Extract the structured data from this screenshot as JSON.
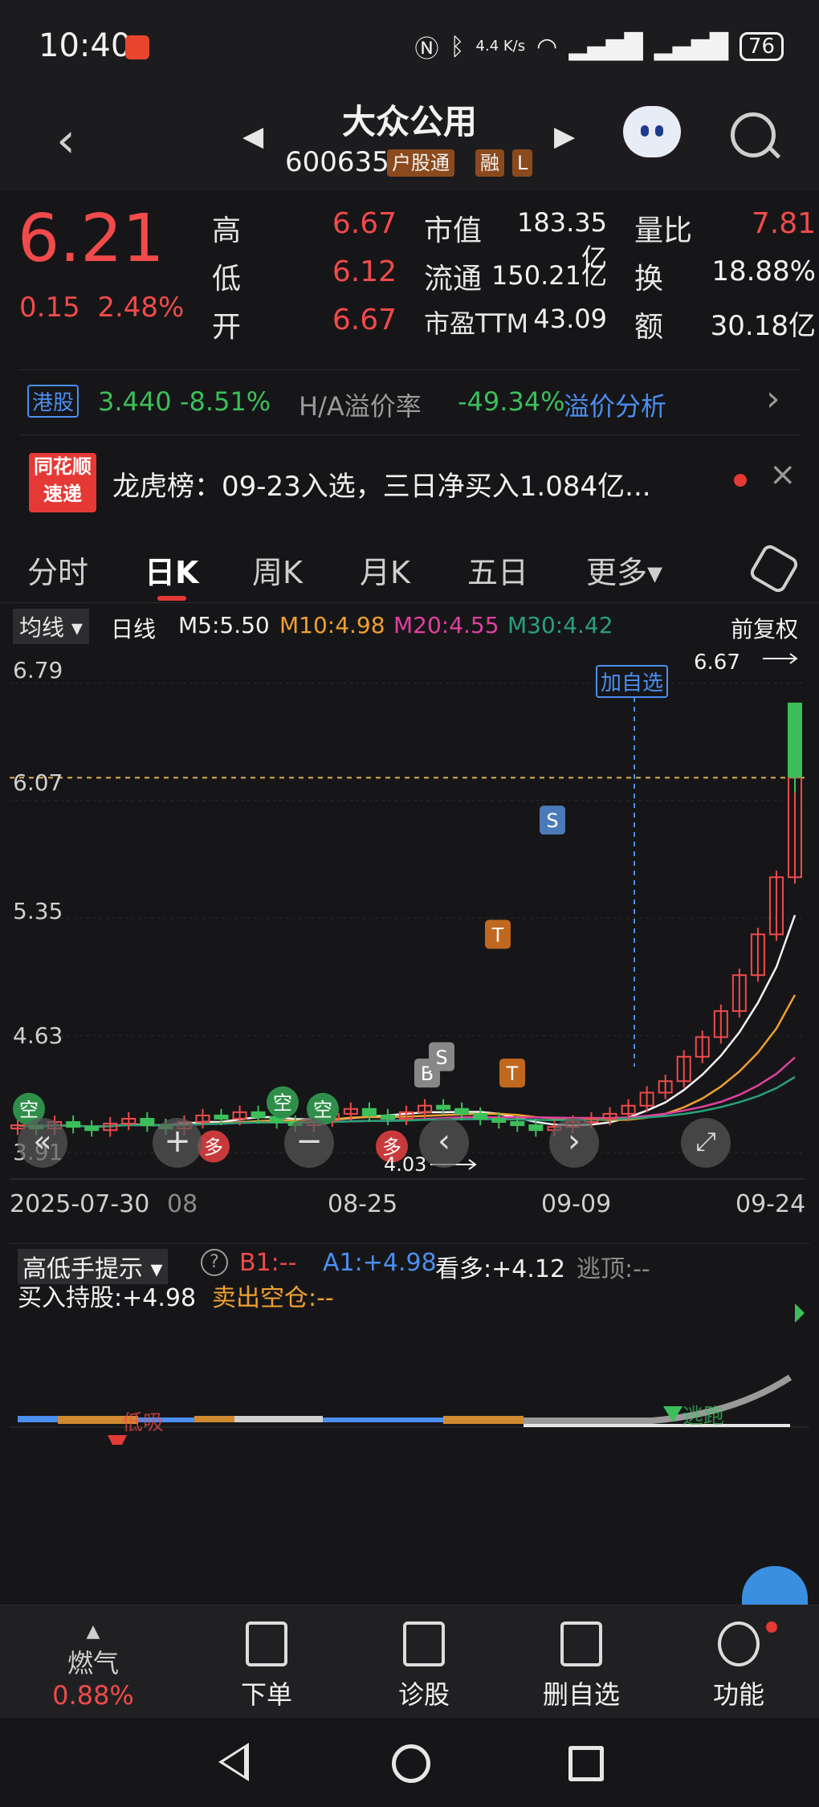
{
  "status_bar": {
    "time": "10:40",
    "net_speed": "4.4 K/s",
    "battery": "76"
  },
  "header": {
    "title": "大众公用",
    "code": "600635",
    "tags": [
      "户股通",
      "融",
      "L"
    ]
  },
  "quote": {
    "price": "6.21",
    "change": "0.15",
    "change_pct": "2.48%",
    "high_label": "高",
    "high": "6.67",
    "low_label": "低",
    "low": "6.12",
    "open_label": "开",
    "open": "6.67",
    "mktcap_label": "市值",
    "mktcap": "183.35亿",
    "float_label": "流通",
    "float": "150.21亿",
    "pe_label": "市盈TTM",
    "pe": "43.09",
    "volratio_label": "量比",
    "volratio": "7.81",
    "turnover_label": "换",
    "turnover": "18.88%",
    "amount_label": "额",
    "amount": "30.18亿"
  },
  "hk": {
    "badge": "港股",
    "price": "3.440",
    "change_pct": "-8.51%",
    "premium_label": "H/A溢价率",
    "premium": "-49.34%",
    "analysis_link": "溢价分析"
  },
  "news": {
    "logo_line1": "同花顺",
    "logo_line2": "速递",
    "text": "龙虎榜：09-23入选，三日净买入1.084亿..."
  },
  "tabs": [
    "分时",
    "日K",
    "周K",
    "月K",
    "五日",
    "更多▾"
  ],
  "ma": {
    "selector": "均线 ▾",
    "period": "日线",
    "m5": "M5:5.50",
    "m10": "M10:4.98",
    "m20": "M20:4.55",
    "m30": "M30:4.42",
    "adjust": "前复权"
  },
  "chart_labels": {
    "y_ticks": [
      "6.79",
      "6.07",
      "5.35",
      "4.63",
      "3.91"
    ],
    "x_ticks": [
      "2025-07-30",
      "08",
      "08-25",
      "09-09",
      "09-24"
    ],
    "add_watch": "加自选",
    "high_marker": "6.67",
    "low_marker": "4.03",
    "signals": [
      "空",
      "空",
      "空",
      "多",
      "多",
      "B",
      "S",
      "T",
      "T",
      "S"
    ]
  },
  "chart_data": {
    "type": "candlestick",
    "y_axis": {
      "ticks": [
        6.79,
        6.07,
        5.35,
        4.63,
        3.91
      ]
    },
    "x_ticks": [
      "2025-07-30",
      "08-25",
      "09-09",
      "09-24"
    ],
    "current_price": 6.21,
    "high": 6.67,
    "low": 4.03,
    "moving_averages": {
      "M5": 5.5,
      "M10": 4.98,
      "M20": 4.55,
      "M30": 4.42
    },
    "candles_close": [
      4.08,
      4.06,
      4.1,
      4.07,
      4.05,
      4.09,
      4.12,
      4.08,
      4.06,
      4.1,
      4.14,
      4.12,
      4.16,
      4.13,
      4.1,
      4.08,
      4.11,
      4.15,
      4.18,
      4.14,
      4.12,
      4.16,
      4.2,
      4.18,
      4.15,
      4.12,
      4.1,
      4.08,
      4.05,
      4.07,
      4.1,
      4.12,
      4.15,
      4.2,
      4.28,
      4.35,
      4.5,
      4.62,
      4.78,
      5.0,
      5.25,
      5.6,
      6.21
    ]
  },
  "indicator": {
    "name": "高低手提示 ▾",
    "help": "?",
    "b1": "B1:--",
    "a1": "A1:+4.98",
    "bull": "看多:+4.12",
    "top": "逃顶:--",
    "hold": "买入持股:+4.98",
    "sell": "卖出空仓:--",
    "low_suck": "低吸",
    "escape": "逃跑"
  },
  "bottom_bar": [
    {
      "label": "燃气",
      "sub": "0.88%"
    },
    {
      "label": "下单"
    },
    {
      "label": "诊股"
    },
    {
      "label": "删自选"
    },
    {
      "label": "功能"
    }
  ]
}
